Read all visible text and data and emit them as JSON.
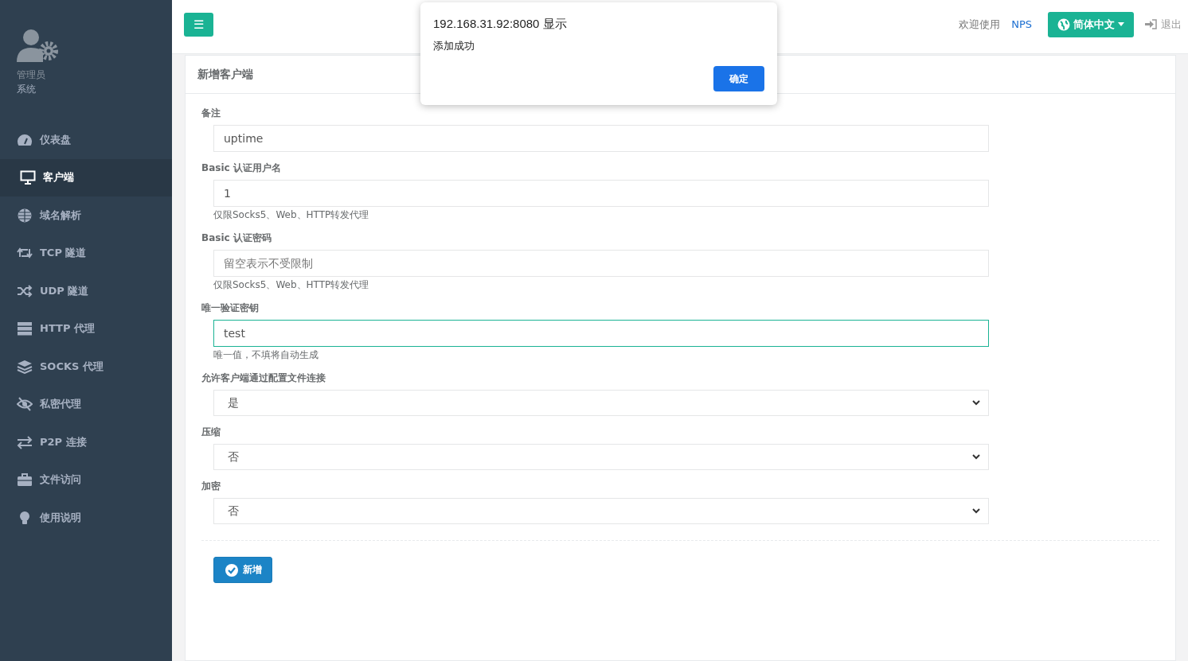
{
  "sidebar": {
    "profile": {
      "name": "管理员",
      "role": "系统"
    },
    "items": [
      {
        "label": "仪表盘",
        "selected": false
      },
      {
        "label": "客户端",
        "selected": true
      },
      {
        "label": "域名解析",
        "selected": false
      },
      {
        "label": "TCP 隧道",
        "selected": false
      },
      {
        "label": "UDP 隧道",
        "selected": false
      },
      {
        "label": "HTTP 代理",
        "selected": false
      },
      {
        "label": "SOCKS 代理",
        "selected": false
      },
      {
        "label": "私密代理",
        "selected": false
      },
      {
        "label": "P2P 连接",
        "selected": false
      },
      {
        "label": "文件访问",
        "selected": false
      },
      {
        "label": "使用说明",
        "selected": false
      }
    ]
  },
  "topbar": {
    "menu_button": "☰",
    "welcome": "欢迎使用",
    "brand": "NPS",
    "language": "简体中文",
    "logout": "退出"
  },
  "panel": {
    "title": "新增客户端",
    "fields": [
      {
        "kind": "text",
        "label": "备注",
        "value": "uptime",
        "focused": false
      },
      {
        "kind": "text",
        "label": "Basic 认证用户名",
        "value": "1",
        "help": "仅限Socks5、Web、HTTP转发代理",
        "focused": false
      },
      {
        "kind": "text",
        "label": "Basic 认证密码",
        "placeholder": "留空表示不受限制",
        "help": "仅限Socks5、Web、HTTP转发代理",
        "focused": false
      },
      {
        "kind": "text",
        "label": "唯一验证密钥",
        "value": "test",
        "help": "唯一值，不填将自动生成",
        "focused": true
      },
      {
        "kind": "select",
        "label": "允许客户端通过配置文件连接",
        "value": "是",
        "focused": false
      },
      {
        "kind": "select",
        "label": "压缩",
        "value": "否",
        "focused": false
      },
      {
        "kind": "select",
        "label": "加密",
        "value": "否",
        "focused": false
      }
    ],
    "submit": "新增"
  },
  "dialog": {
    "title": "192.168.31.92:8080 显示",
    "message": "添加成功",
    "ok": "确定"
  }
}
